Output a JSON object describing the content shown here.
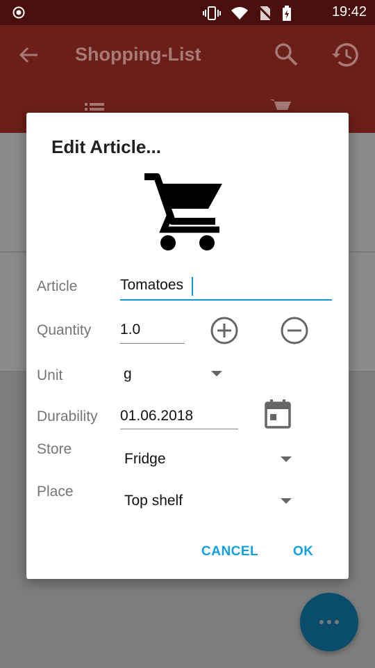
{
  "status_bar": {
    "time": "19:42"
  },
  "app_bar": {
    "title": "Shopping-List"
  },
  "dialog": {
    "title": "Edit Article...",
    "fields": {
      "article": {
        "label": "Article",
        "value": "Tomatoes"
      },
      "quantity": {
        "label": "Quantity",
        "value": "1.0"
      },
      "unit": {
        "label": "Unit",
        "value": "g"
      },
      "durability": {
        "label": "Durability",
        "value": "01.06.2018"
      },
      "store": {
        "label": "Store",
        "value": "Fridge"
      },
      "place": {
        "label": "Place",
        "value": "Top shelf"
      }
    },
    "buttons": {
      "cancel": "CANCEL",
      "ok": "OK"
    }
  },
  "colors": {
    "accent": "#12a0de",
    "primary_dimmed": "#6c1e19",
    "status_bar": "#4a0f0c",
    "fab_dimmed": "#0a4c6b"
  },
  "icons": [
    "cart-icon",
    "plus-circle-icon",
    "minus-circle-icon",
    "calendar-icon",
    "search-icon",
    "history-icon",
    "back-arrow-icon",
    "more-dots-icon"
  ]
}
